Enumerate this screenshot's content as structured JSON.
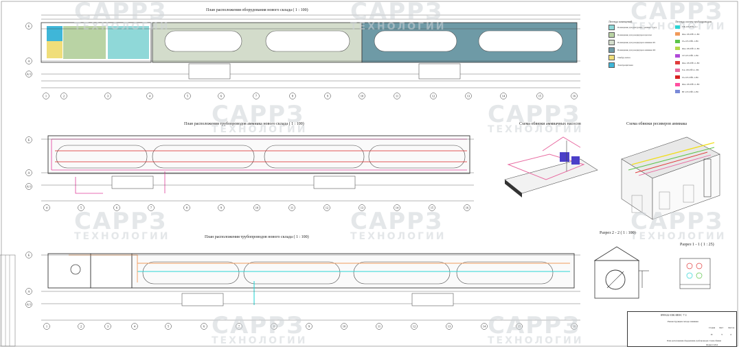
{
  "drawing": {
    "plan1_title": "План расположения оборудования нового склада ( 1 : 100)",
    "plan2_title": "План расположения трубопроводов аммиака нового склада ( 1 : 100)",
    "plan3_title": "План расположения трубопроводов нового склада ( 1 : 100)",
    "pump_scheme_title": "Схема обвязки аммиачных насосов",
    "receiver_scheme_title": "Схема обвязки ресиверов аммиака",
    "section22_title": "Разрез 2 - 2 ( 1 : 100)",
    "section11_title": "Разрез 1 - 1 ( 1 : 25)",
    "row_axes": [
      "Б",
      "А",
      "А/1"
    ],
    "col_axes": [
      "1",
      "2",
      "3",
      "4",
      "5",
      "6",
      "7",
      "8",
      "9",
      "10",
      "11",
      "12",
      "13",
      "14",
      "15",
      "16"
    ]
  },
  "legend": {
    "rooms_title": "Легенда помещений",
    "pipes_title": "Легенда систем трубопроводов",
    "rooms": [
      {
        "label": "Помещение для разгрузки с машин / с ж/д",
        "color": "#8fd8d8"
      },
      {
        "label": "Помещение для резервуаров щелочи",
        "color": "#b9d3a4"
      },
      {
        "label": "Помещение для резервуаров аммиака R1",
        "color": "#d3dccb"
      },
      {
        "label": "Помещение для резервуаров аммиака R2",
        "color": "#6e9aa6"
      },
      {
        "label": "Тамбур-шлюз",
        "color": "#f0de7a"
      },
      {
        "label": "Электрощитовая",
        "color": "#3fb6d8"
      }
    ],
    "pipes": [
      {
        "label": "ГЖ-105-ЕЙ1-1-1",
        "color": "#2bd4d4"
      },
      {
        "label": "ЖА-105-ЕЙ1-1-ВС",
        "color": "#f09a5a"
      },
      {
        "label": "ГА-105-ЕЙ1-1-ВС",
        "color": "#5cc44a"
      },
      {
        "label": "ЖА-105-ЕЙ1-1-ВС",
        "color": "#b5d84a"
      },
      {
        "label": "СР-105-ЕЙ1-1-ВС",
        "color": "#b04ad8"
      },
      {
        "label": "ЖА-105-ЕЙ1-1-ВС",
        "color": "#e03c3c"
      },
      {
        "label": "ЕА-105-ЕЙ1-1-ВС",
        "color": "#e86aa0"
      },
      {
        "label": "ГА-105-ЕЙ1-1-ВС",
        "color": "#d82020"
      },
      {
        "label": "ЖА-105-ЕЙ1-1-ВС",
        "color": "#ff4fa0"
      },
      {
        "label": "ВГ-105-ЕЙ1-1-ВС",
        "color": "#7a8ad8"
      }
    ]
  },
  "watermark": {
    "big": "САРРЗ",
    "sub": "ТЕХНОЛОГИИ"
  },
  "stamp": {
    "code": "099/22-ОК-ИОС 7.1",
    "object": "Реконструкция склада аммиака",
    "stage_label": "Стадия",
    "sheet_label": "Лист",
    "sheets_label": "Листов",
    "stage": "П",
    "sheet": "3",
    "sheets": "4",
    "doc_name": "План расположения оборудования, трубопроводов. Схема обвязки",
    "format": "Формат А3х4"
  }
}
